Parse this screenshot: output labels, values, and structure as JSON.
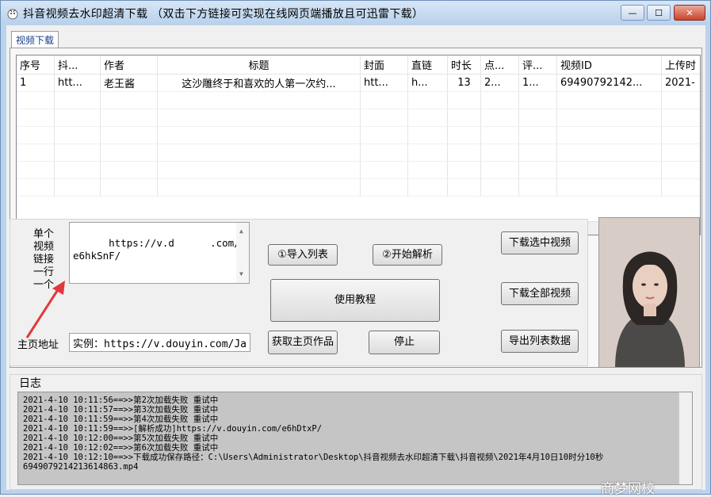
{
  "window": {
    "title": "抖音视频去水印超清下载 （双击下方链接可实现在线网页端播放且可迅雷下载）",
    "min_icon": "minimize-icon",
    "max_icon": "maximize-icon",
    "close_icon": "close-icon"
  },
  "tabs": [
    {
      "label": "视频下载"
    }
  ],
  "table": {
    "columns": [
      "序号",
      "抖...",
      "作者",
      "标题",
      "封面",
      "直链",
      "时长",
      "点...",
      "评...",
      "视频ID",
      "上传时"
    ],
    "rows": [
      [
        "1",
        "htt...",
        "老王酱",
        "这沙雕终于和喜欢的人第一次约...",
        "htt...",
        "h...",
        "13",
        "2...",
        "1...",
        "69490792142...",
        "2021-"
      ]
    ]
  },
  "input": {
    "single_label": "单个视频链接一行一个",
    "url_text": "https://v.d      .com/e6hkSnF/",
    "homepage_label": "主页地址",
    "homepage_value": "实例：https://v.douyin.com/Ja"
  },
  "buttons": {
    "import_list": "①导入列表",
    "start_parse": "②开始解析",
    "tutorial": "使用教程",
    "get_homepage": "获取主页作品",
    "stop": "停止",
    "download_selected": "下载选中视频",
    "download_all": "下载全部视频",
    "export_list": "导出列表数据"
  },
  "log": {
    "title": "日志",
    "lines": [
      "2021-4-10 10:11:56==>>第2次加载失败 重试中",
      "2021-4-10 10:11:57==>>第3次加载失败 重试中",
      "2021-4-10 10:11:59==>>第4次加载失败 重试中",
      "2021-4-10 10:11:59==>>[解析成功]https://v.douyin.com/e6hDtxP/",
      "2021-4-10 10:12:00==>>第5次加载失败 重试中",
      "2021-4-10 10:12:02==>>第6次加载失败 重试中",
      "2021-4-10 10:12:10==>>下载成功保存路径：C:\\Users\\Administrator\\Desktop\\抖音视频去水印超清下载\\抖音视频\\2021年4月10日10时分10秒",
      "6949079214213614863.mp4"
    ]
  },
  "watermark": "商梦网校",
  "colors": {
    "tab_text": "#1a3c8a",
    "title_bar": "#bcd3ec",
    "log_bg": "#c5c5c5",
    "arrow": "#e0393e"
  }
}
